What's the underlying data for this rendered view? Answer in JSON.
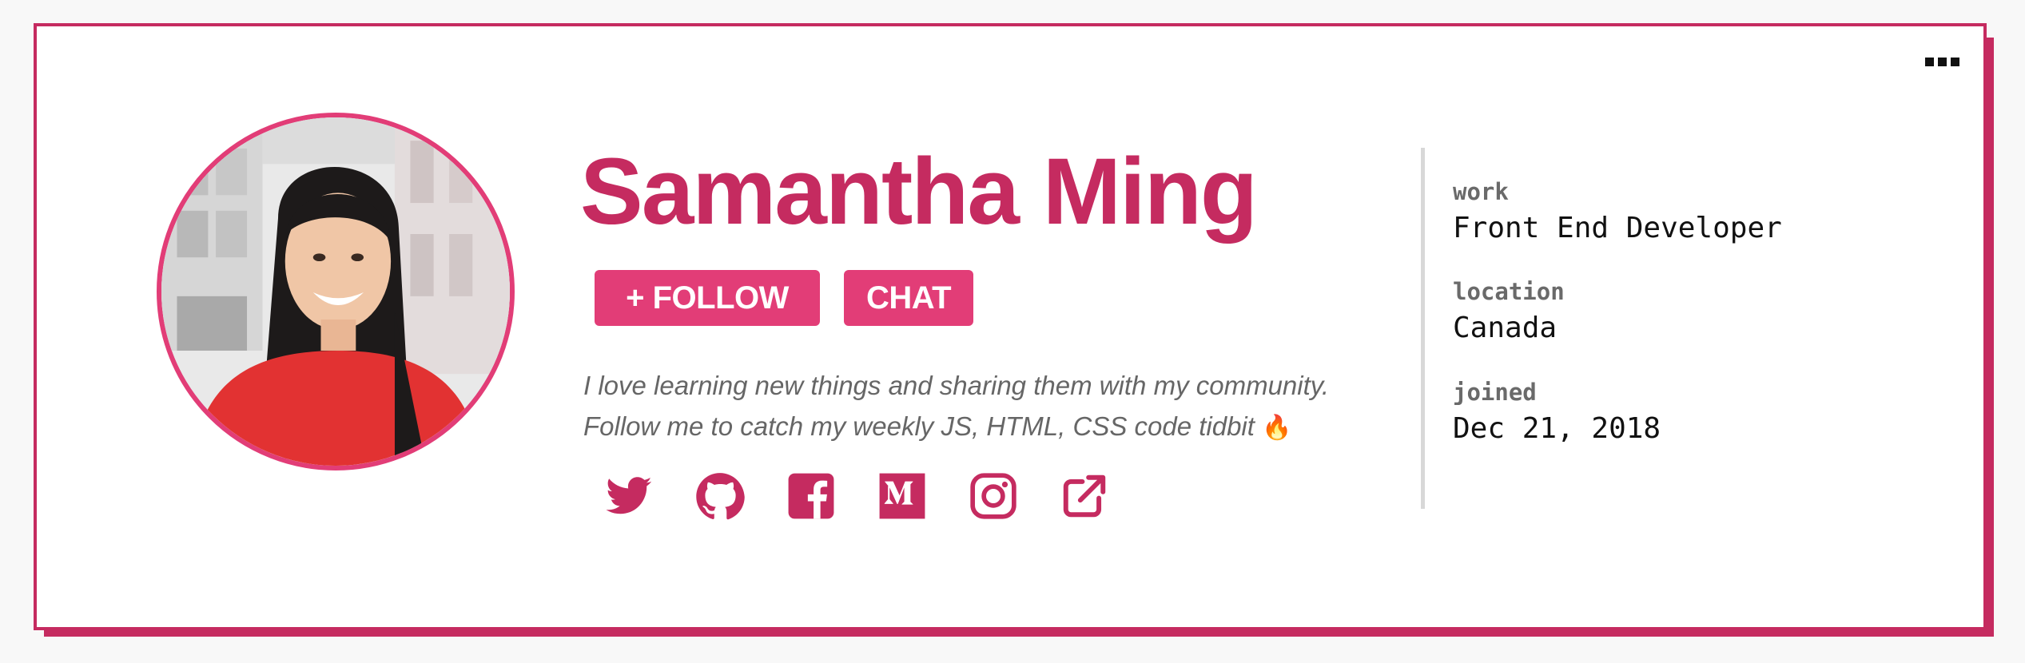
{
  "profile": {
    "name": "Samantha Ming",
    "bio_line1": "I love learning new things and sharing them with my community.",
    "bio_line2": "Follow me to catch my weekly JS, HTML, CSS code tidbit",
    "bio_emoji": "🔥"
  },
  "actions": {
    "follow_label": "+ FOLLOW",
    "chat_label": "CHAT"
  },
  "socials": [
    {
      "icon": "twitter-icon"
    },
    {
      "icon": "github-icon"
    },
    {
      "icon": "facebook-icon"
    },
    {
      "icon": "medium-icon"
    },
    {
      "icon": "instagram-icon"
    },
    {
      "icon": "external-link-icon"
    }
  ],
  "details": {
    "work_label": "work",
    "work_value": "Front End Developer",
    "location_label": "location",
    "location_value": "Canada",
    "joined_label": "joined",
    "joined_value": "Dec 21, 2018"
  },
  "menu": {
    "icon": "more-options-icon"
  },
  "colors": {
    "brand": "#c52b60",
    "accent": "#e23d77",
    "divider": "#d8d8d8",
    "page_background": "#f8f8f8"
  }
}
